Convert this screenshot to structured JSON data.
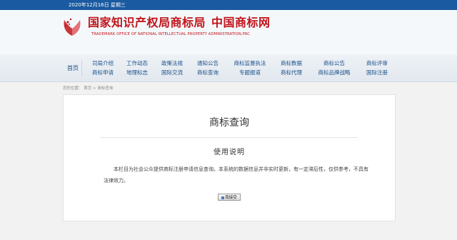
{
  "topbar": {
    "date": "2020年12月16日 星期三"
  },
  "header": {
    "title_part1": "国家知识产权局商标局",
    "title_part2": "中国商标网",
    "subtitle": "TRADEMARK OFFICE OF NATIONAL INTELLECTUAL PROPERTY ADMINISTRATION,PRC",
    "brand_color": "#c0141b"
  },
  "nav": {
    "home": "首页",
    "columns": [
      [
        "司局介绍",
        "商标申请"
      ],
      [
        "工作动态",
        "地理标志"
      ],
      [
        "政策法规",
        "国际交流"
      ],
      [
        "通知公告",
        "商标查询"
      ],
      [
        "商标监督执法",
        "专题报道"
      ],
      [
        "商标数据",
        "商标代理"
      ],
      [
        "商标公告",
        "商标品牌战略"
      ],
      [
        "商标评审",
        "国际注册"
      ]
    ]
  },
  "breadcrumb": {
    "label": "您的位置：",
    "home": "首页",
    "sep": ">",
    "current": "商标查询"
  },
  "main": {
    "title": "商标查询",
    "usage_title": "使用说明",
    "body": "本栏目为社会公众提供商标注册申请信息查询。本系统的数据信息并非实时更新，有一定滞后性，仅供参考，不具有法律效力。",
    "button": "我接受"
  }
}
